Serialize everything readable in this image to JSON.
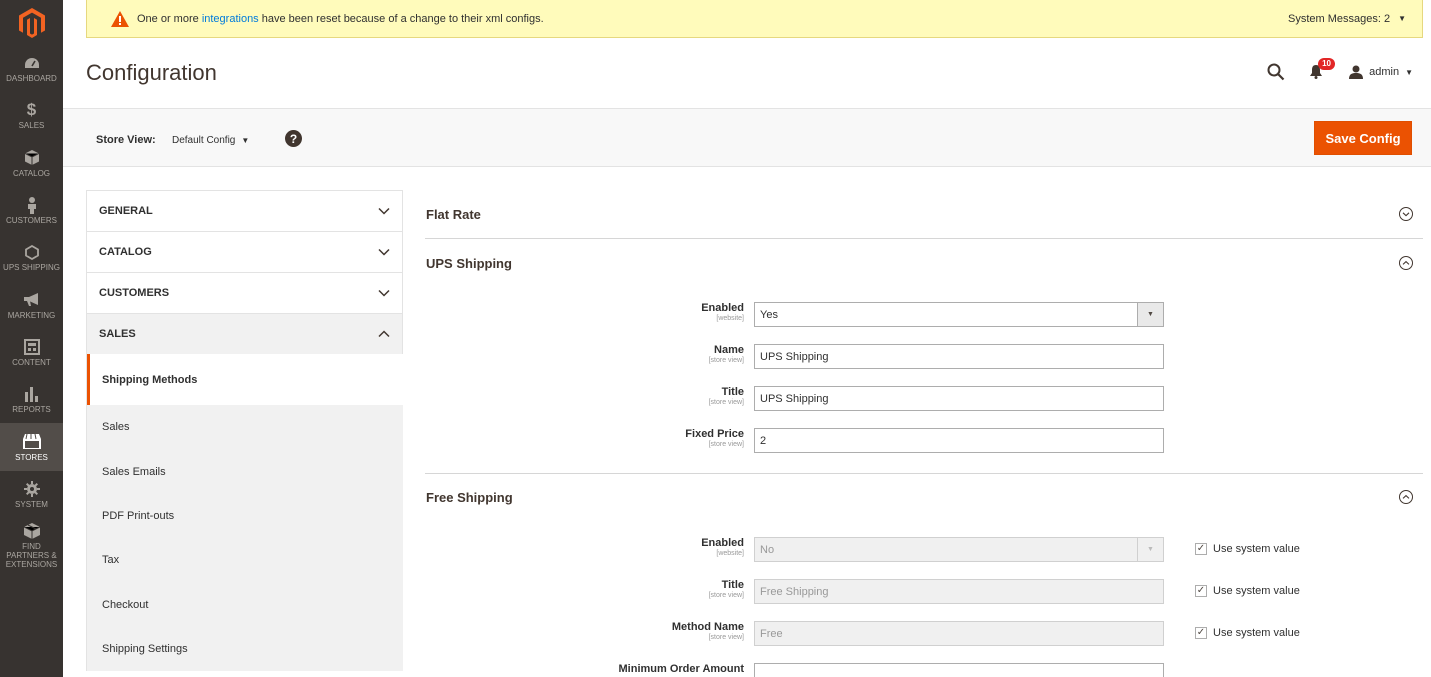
{
  "nav": {
    "items": [
      {
        "label": "DASHBOARD",
        "icon": "dashboard-icon"
      },
      {
        "label": "SALES",
        "icon": "dollar-icon"
      },
      {
        "label": "CATALOG",
        "icon": "cube-icon"
      },
      {
        "label": "CUSTOMERS",
        "icon": "person-icon"
      },
      {
        "label": "UPS SHIPPING",
        "icon": "hexagon-icon"
      },
      {
        "label": "MARKETING",
        "icon": "megaphone-icon"
      },
      {
        "label": "CONTENT",
        "icon": "layout-icon"
      },
      {
        "label": "REPORTS",
        "icon": "bar-chart-icon"
      },
      {
        "label": "STORES",
        "icon": "store-icon"
      },
      {
        "label": "SYSTEM",
        "icon": "gear-icon"
      },
      {
        "label": "FIND PARTNERS & EXTENSIONS",
        "icon": "box-icon"
      }
    ],
    "active": "STORES"
  },
  "system_message": {
    "text_before": "One or more ",
    "link": "integrations",
    "text_after": " have been reset because of a change to their xml configs.",
    "counter": "System Messages: 2"
  },
  "header": {
    "title": "Configuration",
    "notifications_count": "10",
    "user": "admin"
  },
  "store_view": {
    "label": "Store View:",
    "value": "Default Config",
    "help": "?",
    "save_label": "Save Config"
  },
  "tabs": {
    "general": "GENERAL",
    "catalog": "CATALOG",
    "customers": "CUSTOMERS",
    "sales": "SALES",
    "sales_items": [
      "Shipping Methods",
      "Sales",
      "Sales Emails",
      "PDF Print-outs",
      "Tax",
      "Checkout",
      "Shipping Settings"
    ]
  },
  "sections": {
    "flat_rate": "Flat Rate",
    "ups": {
      "title": "UPS Shipping",
      "enabled": {
        "label": "Enabled",
        "scope": "[website]",
        "value": "Yes"
      },
      "name": {
        "label": "Name",
        "scope": "[store view]",
        "value": "UPS Shipping"
      },
      "title_field": {
        "label": "Title",
        "scope": "[store view]",
        "value": "UPS Shipping"
      },
      "fixed_price": {
        "label": "Fixed Price",
        "scope": "[store view]",
        "value": "2"
      }
    },
    "free": {
      "title": "Free Shipping",
      "enabled": {
        "label": "Enabled",
        "scope": "[website]",
        "value": "No"
      },
      "title_field": {
        "label": "Title",
        "scope": "[store view]",
        "value": "Free Shipping"
      },
      "method_name": {
        "label": "Method Name",
        "scope": "[store view]",
        "value": "Free"
      },
      "min_order": {
        "label": "Minimum Order Amount",
        "value": ""
      },
      "use_system_value": "Use system value"
    }
  },
  "colors": {
    "accent": "#eb5202",
    "nav_bg": "#373330",
    "message_bg": "#fffbbb",
    "link": "#007bdb"
  }
}
